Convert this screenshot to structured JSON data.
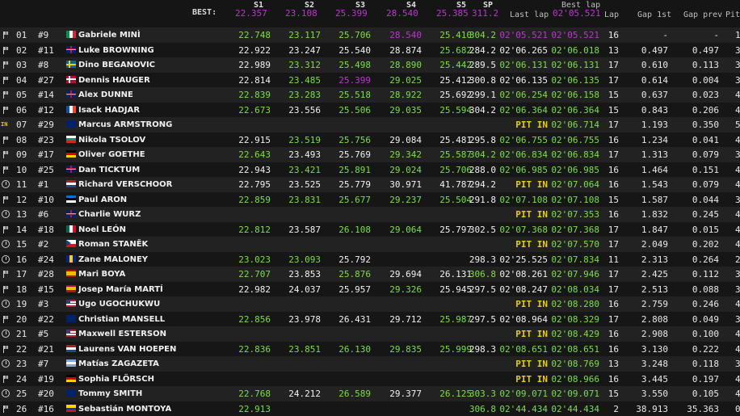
{
  "header": {
    "best_label": "BEST:",
    "cols": {
      "s1": "S1",
      "s2": "S2",
      "s3": "S3",
      "s4": "S4",
      "s5": "S5",
      "sp": "SP",
      "last_lap": "Last lap",
      "best_lap": "Best lap",
      "lap": "Lap",
      "gap_1st": "Gap 1st",
      "gap_prev": "Gap prev",
      "pit": "Pit"
    },
    "best": {
      "s1": "22.357",
      "s2": "23.108",
      "s3": "25.399",
      "s4": "28.540",
      "s5": "25.385",
      "sp": "311.2",
      "best_lap": "02'05.521"
    }
  },
  "colors": {
    "green": "#7ae03c",
    "purple": "#c133d6",
    "yellow": "#e6d000",
    "white": "#f0f0f0"
  },
  "rows": [
    {
      "status": "flag",
      "pos": "01",
      "num": "#9",
      "flag": "it",
      "name": "Gabriele MINÌ",
      "s1": {
        "v": "22.748",
        "c": "green"
      },
      "s2": {
        "v": "23.117",
        "c": "green"
      },
      "s3": {
        "v": "25.706",
        "c": "green"
      },
      "s4": {
        "v": "28.540",
        "c": "purple"
      },
      "s5": {
        "v": "25.410",
        "c": "green"
      },
      "sp": {
        "v": "304.2",
        "c": "green"
      },
      "last": {
        "v": "02'05.521",
        "c": "purple"
      },
      "best": {
        "v": "02'05.521",
        "c": "purple"
      },
      "lap": "16",
      "gap1": "-",
      "gapp": "-",
      "pit": "1"
    },
    {
      "status": "flag",
      "pos": "02",
      "num": "#11",
      "flag": "gb",
      "name": "Luke BROWNING",
      "s1": {
        "v": "22.922",
        "c": "white"
      },
      "s2": {
        "v": "23.247",
        "c": "white"
      },
      "s3": {
        "v": "25.540",
        "c": "white"
      },
      "s4": {
        "v": "28.874",
        "c": "white"
      },
      "s5": {
        "v": "25.682",
        "c": "green"
      },
      "sp": {
        "v": "284.2",
        "c": "white"
      },
      "last": {
        "v": "02'06.265",
        "c": "white"
      },
      "best": {
        "v": "02'06.018",
        "c": "green"
      },
      "lap": "13",
      "gap1": "0.497",
      "gapp": "0.497",
      "pit": "3"
    },
    {
      "status": "flag",
      "pos": "03",
      "num": "#8",
      "flag": "se",
      "name": "Dino BEGANOVIC",
      "s1": {
        "v": "22.989",
        "c": "white"
      },
      "s2": {
        "v": "23.312",
        "c": "green"
      },
      "s3": {
        "v": "25.498",
        "c": "green"
      },
      "s4": {
        "v": "28.890",
        "c": "green"
      },
      "s5": {
        "v": "25.442",
        "c": "green"
      },
      "sp": {
        "v": "289.5",
        "c": "white"
      },
      "last": {
        "v": "02'06.131",
        "c": "green"
      },
      "best": {
        "v": "02'06.131",
        "c": "green"
      },
      "lap": "17",
      "gap1": "0.610",
      "gapp": "0.113",
      "pit": "3"
    },
    {
      "status": "flag",
      "pos": "04",
      "num": "#27",
      "flag": "no",
      "name": "Dennis HAUGER",
      "s1": {
        "v": "22.814",
        "c": "white"
      },
      "s2": {
        "v": "23.485",
        "c": "green"
      },
      "s3": {
        "v": "25.399",
        "c": "purple"
      },
      "s4": {
        "v": "29.025",
        "c": "green"
      },
      "s5": {
        "v": "25.412",
        "c": "white"
      },
      "sp": {
        "v": "300.8",
        "c": "white"
      },
      "last": {
        "v": "02'06.135",
        "c": "white"
      },
      "best": {
        "v": "02'06.135",
        "c": "green"
      },
      "lap": "17",
      "gap1": "0.614",
      "gapp": "0.004",
      "pit": "3"
    },
    {
      "status": "flag",
      "pos": "05",
      "num": "#14",
      "flag": "gb",
      "name": "Alex DUNNE",
      "s1": {
        "v": "22.839",
        "c": "green"
      },
      "s2": {
        "v": "23.283",
        "c": "green"
      },
      "s3": {
        "v": "25.518",
        "c": "green"
      },
      "s4": {
        "v": "28.922",
        "c": "green"
      },
      "s5": {
        "v": "25.692",
        "c": "white"
      },
      "sp": {
        "v": "299.1",
        "c": "white"
      },
      "last": {
        "v": "02'06.254",
        "c": "green"
      },
      "best": {
        "v": "02'06.158",
        "c": "green"
      },
      "lap": "15",
      "gap1": "0.637",
      "gapp": "0.023",
      "pit": "4"
    },
    {
      "status": "flag",
      "pos": "06",
      "num": "#12",
      "flag": "fr",
      "name": "Isack HADJAR",
      "s1": {
        "v": "22.673",
        "c": "green"
      },
      "s2": {
        "v": "23.556",
        "c": "white"
      },
      "s3": {
        "v": "25.506",
        "c": "green"
      },
      "s4": {
        "v": "29.035",
        "c": "green"
      },
      "s5": {
        "v": "25.594",
        "c": "green"
      },
      "sp": {
        "v": "304.2",
        "c": "white"
      },
      "last": {
        "v": "02'06.364",
        "c": "green"
      },
      "best": {
        "v": "02'06.364",
        "c": "green"
      },
      "lap": "15",
      "gap1": "0.843",
      "gapp": "0.206",
      "pit": "4"
    },
    {
      "status": "pitin",
      "status_text": "IN",
      "pos": "07",
      "num": "#29",
      "flag": "au",
      "name": "Marcus ARMSTRONG",
      "s1": {
        "v": "",
        "c": "white"
      },
      "s2": {
        "v": "",
        "c": "white"
      },
      "s3": {
        "v": "",
        "c": "white"
      },
      "s4": {
        "v": "",
        "c": "white"
      },
      "s5": {
        "v": "",
        "c": "white"
      },
      "sp": {
        "v": "",
        "c": "white"
      },
      "last": {
        "v": "PIT IN",
        "c": "yellow"
      },
      "best": {
        "v": "02'06.714",
        "c": "green"
      },
      "lap": "17",
      "gap1": "1.193",
      "gapp": "0.350",
      "pit": "5"
    },
    {
      "status": "flag",
      "pos": "08",
      "num": "#23",
      "flag": "bg",
      "name": "Nikola TSOLOV",
      "s1": {
        "v": "22.915",
        "c": "white"
      },
      "s2": {
        "v": "23.519",
        "c": "green"
      },
      "s3": {
        "v": "25.756",
        "c": "green"
      },
      "s4": {
        "v": "29.084",
        "c": "white"
      },
      "s5": {
        "v": "25.481",
        "c": "white"
      },
      "sp": {
        "v": "295.8",
        "c": "white"
      },
      "last": {
        "v": "02'06.755",
        "c": "green"
      },
      "best": {
        "v": "02'06.755",
        "c": "green"
      },
      "lap": "16",
      "gap1": "1.234",
      "gapp": "0.041",
      "pit": "4"
    },
    {
      "status": "flag",
      "pos": "09",
      "num": "#17",
      "flag": "de",
      "name": "Oliver GOETHE",
      "s1": {
        "v": "22.643",
        "c": "green"
      },
      "s2": {
        "v": "23.493",
        "c": "white"
      },
      "s3": {
        "v": "25.769",
        "c": "white"
      },
      "s4": {
        "v": "29.342",
        "c": "green"
      },
      "s5": {
        "v": "25.587",
        "c": "green"
      },
      "sp": {
        "v": "304.2",
        "c": "green"
      },
      "last": {
        "v": "02'06.834",
        "c": "green"
      },
      "best": {
        "v": "02'06.834",
        "c": "green"
      },
      "lap": "17",
      "gap1": "1.313",
      "gapp": "0.079",
      "pit": "3"
    },
    {
      "status": "flag",
      "pos": "10",
      "num": "#25",
      "flag": "gb",
      "name": "Dan TICKTUM",
      "s1": {
        "v": "22.943",
        "c": "white"
      },
      "s2": {
        "v": "23.421",
        "c": "green"
      },
      "s3": {
        "v": "25.891",
        "c": "green"
      },
      "s4": {
        "v": "29.024",
        "c": "green"
      },
      "s5": {
        "v": "25.706",
        "c": "green"
      },
      "sp": {
        "v": "288.0",
        "c": "white"
      },
      "last": {
        "v": "02'06.985",
        "c": "green"
      },
      "best": {
        "v": "02'06.985",
        "c": "green"
      },
      "lap": "16",
      "gap1": "1.464",
      "gapp": "0.151",
      "pit": "4"
    },
    {
      "status": "clock",
      "pos": "11",
      "num": "#1",
      "flag": "nl",
      "name": "Richard VERSCHOOR",
      "s1": {
        "v": "22.795",
        "c": "white"
      },
      "s2": {
        "v": "23.525",
        "c": "white"
      },
      "s3": {
        "v": "25.779",
        "c": "white"
      },
      "s4": {
        "v": "30.971",
        "c": "white"
      },
      "s5": {
        "v": "41.787",
        "c": "white"
      },
      "sp": {
        "v": "294.2",
        "c": "white"
      },
      "last": {
        "v": "PIT IN",
        "c": "yellow"
      },
      "best": {
        "v": "02'07.064",
        "c": "green"
      },
      "lap": "16",
      "gap1": "1.543",
      "gapp": "0.079",
      "pit": "4"
    },
    {
      "status": "flag",
      "pos": "12",
      "num": "#10",
      "flag": "ee",
      "name": "Paul ARON",
      "s1": {
        "v": "22.859",
        "c": "green"
      },
      "s2": {
        "v": "23.831",
        "c": "green"
      },
      "s3": {
        "v": "25.677",
        "c": "green"
      },
      "s4": {
        "v": "29.237",
        "c": "green"
      },
      "s5": {
        "v": "25.504",
        "c": "green"
      },
      "sp": {
        "v": "291.8",
        "c": "white"
      },
      "last": {
        "v": "02'07.108",
        "c": "green"
      },
      "best": {
        "v": "02'07.108",
        "c": "green"
      },
      "lap": "15",
      "gap1": "1.587",
      "gapp": "0.044",
      "pit": "3"
    },
    {
      "status": "clock",
      "pos": "13",
      "num": "#6",
      "flag": "gb",
      "name": "Charlie WURZ",
      "s1": {
        "v": "",
        "c": "white"
      },
      "s2": {
        "v": "",
        "c": "white"
      },
      "s3": {
        "v": "",
        "c": "white"
      },
      "s4": {
        "v": "",
        "c": "white"
      },
      "s5": {
        "v": "",
        "c": "white"
      },
      "sp": {
        "v": "",
        "c": "white"
      },
      "last": {
        "v": "PIT IN",
        "c": "yellow"
      },
      "best": {
        "v": "02'07.353",
        "c": "green"
      },
      "lap": "16",
      "gap1": "1.832",
      "gapp": "0.245",
      "pit": "4"
    },
    {
      "status": "flag",
      "pos": "14",
      "num": "#18",
      "flag": "mx",
      "name": "Noel LEÓN",
      "s1": {
        "v": "22.812",
        "c": "green"
      },
      "s2": {
        "v": "23.587",
        "c": "white"
      },
      "s3": {
        "v": "26.108",
        "c": "green"
      },
      "s4": {
        "v": "29.064",
        "c": "green"
      },
      "s5": {
        "v": "25.797",
        "c": "white"
      },
      "sp": {
        "v": "302.5",
        "c": "white"
      },
      "last": {
        "v": "02'07.368",
        "c": "green"
      },
      "best": {
        "v": "02'07.368",
        "c": "green"
      },
      "lap": "17",
      "gap1": "1.847",
      "gapp": "0.015",
      "pit": "4"
    },
    {
      "status": "clock",
      "pos": "15",
      "num": "#2",
      "flag": "cz",
      "name": "Roman STANĚK",
      "s1": {
        "v": "",
        "c": "white"
      },
      "s2": {
        "v": "",
        "c": "white"
      },
      "s3": {
        "v": "",
        "c": "white"
      },
      "s4": {
        "v": "",
        "c": "white"
      },
      "s5": {
        "v": "",
        "c": "white"
      },
      "sp": {
        "v": "",
        "c": "white"
      },
      "last": {
        "v": "PIT IN",
        "c": "yellow"
      },
      "best": {
        "v": "02'07.570",
        "c": "green"
      },
      "lap": "17",
      "gap1": "2.049",
      "gapp": "0.202",
      "pit": "4"
    },
    {
      "status": "clock",
      "pos": "16",
      "num": "#24",
      "flag": "bb",
      "name": "Zane MALONEY",
      "s1": {
        "v": "23.023",
        "c": "green"
      },
      "s2": {
        "v": "23.093",
        "c": "green"
      },
      "s3": {
        "v": "25.792",
        "c": "white"
      },
      "s4": {
        "v": "",
        "c": "white"
      },
      "s5": {
        "v": "",
        "c": "white"
      },
      "sp": {
        "v": "298.3",
        "c": "white"
      },
      "last": {
        "v": "02'25.525",
        "c": "white"
      },
      "best": {
        "v": "02'07.834",
        "c": "green"
      },
      "lap": "11",
      "gap1": "2.313",
      "gapp": "0.264",
      "pit": "2"
    },
    {
      "status": "flag",
      "pos": "17",
      "num": "#28",
      "flag": "es",
      "name": "Mari BOYA",
      "s1": {
        "v": "22.707",
        "c": "green"
      },
      "s2": {
        "v": "23.853",
        "c": "white"
      },
      "s3": {
        "v": "25.876",
        "c": "green"
      },
      "s4": {
        "v": "29.694",
        "c": "white"
      },
      "s5": {
        "v": "26.131",
        "c": "white"
      },
      "sp": {
        "v": "306.8",
        "c": "green"
      },
      "last": {
        "v": "02'08.261",
        "c": "white"
      },
      "best": {
        "v": "02'07.946",
        "c": "green"
      },
      "lap": "17",
      "gap1": "2.425",
      "gapp": "0.112",
      "pit": "3"
    },
    {
      "status": "flag",
      "pos": "18",
      "num": "#15",
      "flag": "es",
      "name": "Josep María MARTÍ",
      "s1": {
        "v": "22.982",
        "c": "white"
      },
      "s2": {
        "v": "24.037",
        "c": "white"
      },
      "s3": {
        "v": "25.957",
        "c": "white"
      },
      "s4": {
        "v": "29.326",
        "c": "green"
      },
      "s5": {
        "v": "25.945",
        "c": "white"
      },
      "sp": {
        "v": "297.5",
        "c": "white"
      },
      "last": {
        "v": "02'08.247",
        "c": "white"
      },
      "best": {
        "v": "02'08.034",
        "c": "green"
      },
      "lap": "17",
      "gap1": "2.513",
      "gapp": "0.088",
      "pit": "3"
    },
    {
      "status": "clock",
      "pos": "19",
      "num": "#3",
      "flag": "us",
      "name": "Ugo UGOCHUKWU",
      "s1": {
        "v": "",
        "c": "white"
      },
      "s2": {
        "v": "",
        "c": "white"
      },
      "s3": {
        "v": "",
        "c": "white"
      },
      "s4": {
        "v": "",
        "c": "white"
      },
      "s5": {
        "v": "",
        "c": "white"
      },
      "sp": {
        "v": "",
        "c": "white"
      },
      "last": {
        "v": "PIT IN",
        "c": "yellow"
      },
      "best": {
        "v": "02'08.280",
        "c": "green"
      },
      "lap": "16",
      "gap1": "2.759",
      "gapp": "0.246",
      "pit": "4"
    },
    {
      "status": "flag",
      "pos": "20",
      "num": "#22",
      "flag": "au",
      "name": "Christian MANSELL",
      "s1": {
        "v": "22.856",
        "c": "green"
      },
      "s2": {
        "v": "23.978",
        "c": "white"
      },
      "s3": {
        "v": "26.431",
        "c": "white"
      },
      "s4": {
        "v": "29.712",
        "c": "white"
      },
      "s5": {
        "v": "25.987",
        "c": "green"
      },
      "sp": {
        "v": "297.5",
        "c": "white"
      },
      "last": {
        "v": "02'08.964",
        "c": "white"
      },
      "best": {
        "v": "02'08.329",
        "c": "green"
      },
      "lap": "17",
      "gap1": "2.808",
      "gapp": "0.049",
      "pit": "3"
    },
    {
      "status": "clock",
      "pos": "21",
      "num": "#5",
      "flag": "us",
      "name": "Maxwell ESTERSON",
      "s1": {
        "v": "",
        "c": "white"
      },
      "s2": {
        "v": "",
        "c": "white"
      },
      "s3": {
        "v": "",
        "c": "white"
      },
      "s4": {
        "v": "",
        "c": "white"
      },
      "s5": {
        "v": "",
        "c": "white"
      },
      "sp": {
        "v": "",
        "c": "white"
      },
      "last": {
        "v": "PIT IN",
        "c": "yellow"
      },
      "best": {
        "v": "02'08.429",
        "c": "green"
      },
      "lap": "16",
      "gap1": "2.908",
      "gapp": "0.100",
      "pit": "4"
    },
    {
      "status": "flag",
      "pos": "22",
      "num": "#21",
      "flag": "nl",
      "name": "Laurens VAN HOEPEN",
      "s1": {
        "v": "22.836",
        "c": "green"
      },
      "s2": {
        "v": "23.851",
        "c": "green"
      },
      "s3": {
        "v": "26.130",
        "c": "green"
      },
      "s4": {
        "v": "29.835",
        "c": "green"
      },
      "s5": {
        "v": "25.999",
        "c": "green"
      },
      "sp": {
        "v": "298.3",
        "c": "white"
      },
      "last": {
        "v": "02'08.651",
        "c": "green"
      },
      "best": {
        "v": "02'08.651",
        "c": "green"
      },
      "lap": "16",
      "gap1": "3.130",
      "gapp": "0.222",
      "pit": "4"
    },
    {
      "status": "clock",
      "pos": "23",
      "num": "#7",
      "flag": "ar",
      "name": "Matías ZAGAZETA",
      "s1": {
        "v": "",
        "c": "white"
      },
      "s2": {
        "v": "",
        "c": "white"
      },
      "s3": {
        "v": "",
        "c": "white"
      },
      "s4": {
        "v": "",
        "c": "white"
      },
      "s5": {
        "v": "",
        "c": "white"
      },
      "sp": {
        "v": "",
        "c": "white"
      },
      "last": {
        "v": "PIT IN",
        "c": "yellow"
      },
      "best": {
        "v": "02'08.769",
        "c": "green"
      },
      "lap": "13",
      "gap1": "3.248",
      "gapp": "0.118",
      "pit": "3"
    },
    {
      "status": "flag",
      "pos": "24",
      "num": "#19",
      "flag": "de",
      "name": "Sophia FLÖRSCH",
      "s1": {
        "v": "",
        "c": "white"
      },
      "s2": {
        "v": "",
        "c": "white"
      },
      "s3": {
        "v": "",
        "c": "white"
      },
      "s4": {
        "v": "",
        "c": "white"
      },
      "s5": {
        "v": "",
        "c": "white"
      },
      "sp": {
        "v": "",
        "c": "white"
      },
      "last": {
        "v": "PIT IN",
        "c": "yellow"
      },
      "best": {
        "v": "02'08.966",
        "c": "green"
      },
      "lap": "16",
      "gap1": "3.445",
      "gapp": "0.197",
      "pit": "4"
    },
    {
      "status": "clock",
      "pos": "25",
      "num": "#20",
      "flag": "nz",
      "name": "Tommy SMITH",
      "s1": {
        "v": "22.768",
        "c": "green"
      },
      "s2": {
        "v": "24.212",
        "c": "white"
      },
      "s3": {
        "v": "26.589",
        "c": "green"
      },
      "s4": {
        "v": "29.377",
        "c": "white"
      },
      "s5": {
        "v": "26.125",
        "c": "green"
      },
      "sp": {
        "v": "303.3",
        "c": "green"
      },
      "last": {
        "v": "02'09.071",
        "c": "green"
      },
      "best": {
        "v": "02'09.071",
        "c": "green"
      },
      "lap": "15",
      "gap1": "3.550",
      "gapp": "0.105",
      "pit": "4"
    },
    {
      "status": "flag",
      "pos": "26",
      "num": "#16",
      "flag": "co",
      "name": "Sebastián MONTOYA",
      "s1": {
        "v": "22.913",
        "c": "green"
      },
      "s2": {
        "v": "",
        "c": "white"
      },
      "s3": {
        "v": "",
        "c": "white"
      },
      "s4": {
        "v": "",
        "c": "white"
      },
      "s5": {
        "v": "",
        "c": "white"
      },
      "sp": {
        "v": "306.8",
        "c": "green"
      },
      "last": {
        "v": "02'44.434",
        "c": "green"
      },
      "best": {
        "v": "02'44.434",
        "c": "green"
      },
      "lap": "2",
      "gap1": "38.913",
      "gapp": "35.363",
      "pit": "0"
    }
  ]
}
